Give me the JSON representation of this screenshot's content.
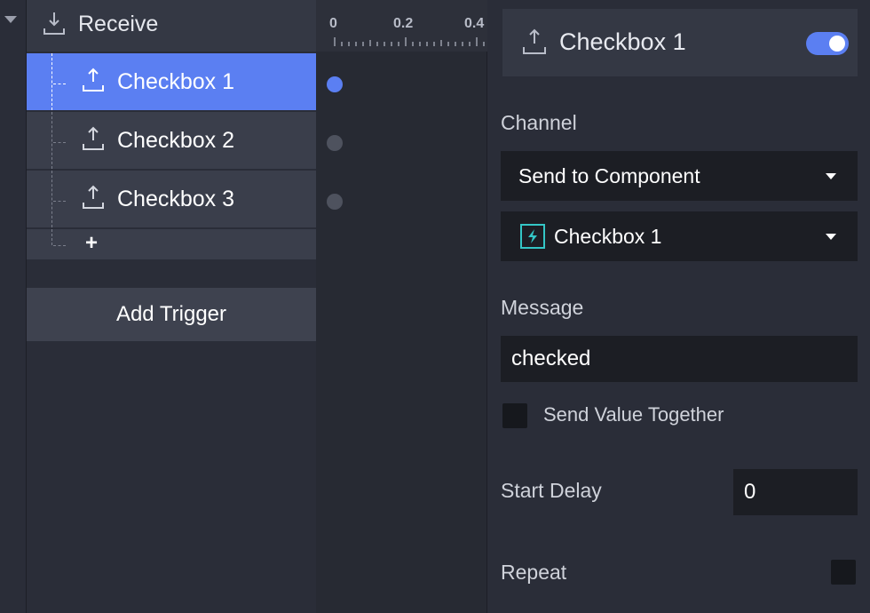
{
  "tree": {
    "parent_label": "Receive",
    "items": [
      {
        "label": "Checkbox 1"
      },
      {
        "label": "Checkbox 2"
      },
      {
        "label": "Checkbox 3"
      }
    ],
    "add_symbol": "+",
    "add_trigger_label": "Add Trigger"
  },
  "timeline": {
    "ticks": [
      "0",
      "0.2",
      "0.4"
    ]
  },
  "panel": {
    "title": "Checkbox 1",
    "enabled": true,
    "channel_label": "Channel",
    "channel_value": "Send to Component",
    "component_value": "Checkbox 1",
    "message_label": "Message",
    "message_value": "checked",
    "send_value_label": "Send Value Together",
    "send_value_checked": false,
    "start_delay_label": "Start Delay",
    "start_delay_value": "0",
    "repeat_label": "Repeat",
    "repeat_checked": false
  },
  "colors": {
    "accent": "#5b7ff2",
    "component_icon": "#34c6c6"
  }
}
